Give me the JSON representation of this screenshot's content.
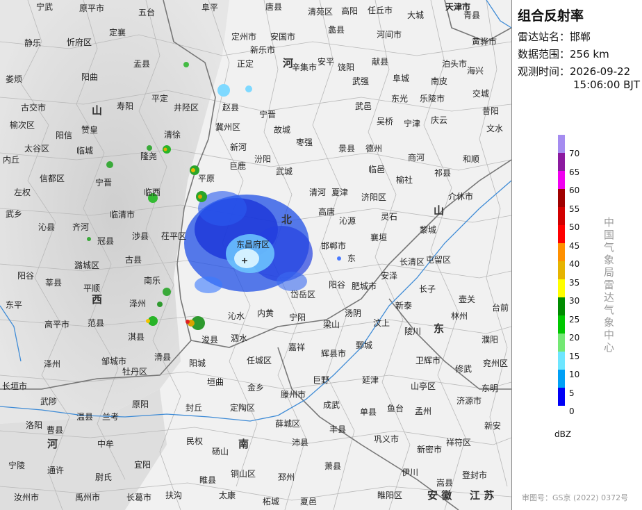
{
  "panel": {
    "title": "组合反射率",
    "station_label": "雷达站名：",
    "station_value": "邯郸",
    "range_label": "数据范围：",
    "range_value": "256 km",
    "time_label": "观测时间：",
    "date_value": "2026-09-22",
    "time_value": "15:06:00 BJT",
    "legend_unit": "dBZ",
    "source": "中国气象局雷达气象中心",
    "review_number": "审图号：GS京 (2022) 0372号",
    "legend": [
      {
        "label": "70",
        "color": "#a58cf0"
      },
      {
        "label": "65",
        "color": "#8c1aa0"
      },
      {
        "label": "60",
        "color": "#f000f0"
      },
      {
        "label": "55",
        "color": "#a00000"
      },
      {
        "label": "50",
        "color": "#d20000"
      },
      {
        "label": "45",
        "color": "#ff0000"
      },
      {
        "label": "40",
        "color": "#ff9000"
      },
      {
        "label": "35",
        "color": "#e6b400"
      },
      {
        "label": "30",
        "color": "#ffff00"
      },
      {
        "label": "25",
        "color": "#008c00"
      },
      {
        "label": "20",
        "color": "#00c800"
      },
      {
        "label": "15",
        "color": "#74e874"
      },
      {
        "label": "10",
        "color": "#6ee6ff"
      },
      {
        "label": "5",
        "color": "#00a0f6"
      },
      {
        "label": "0",
        "color": "#0000f6"
      }
    ]
  },
  "map": {
    "provinces": [
      "山",
      "西",
      "河",
      "北",
      "山",
      "东",
      "河",
      "南",
      "安 徽",
      "江 苏"
    ],
    "places": [
      "宁武",
      "原平市",
      "五台",
      "阜平",
      "唐县",
      "清苑区",
      "高阳",
      "任丘市",
      "大城",
      "天津市",
      "青县",
      "静乐",
      "忻府区",
      "定襄",
      "定州市",
      "安国市",
      "蠡县",
      "河间市",
      "黄骅市",
      "新乐市",
      "盂县",
      "正定",
      "辛集市",
      "安平",
      "饶阳",
      "献县",
      "泊头市",
      "海兴",
      "娄烦",
      "阳曲",
      "武强",
      "阜城",
      "南皮",
      "平定",
      "寿阳",
      "古交市",
      "井陉区",
      "赵县",
      "宁晋",
      "武邑",
      "东光",
      "乐陵市",
      "交城",
      "榆次区",
      "赞皇",
      "冀州区",
      "故城",
      "吴桥",
      "宁津",
      "庆云",
      "昔阳",
      "清徐",
      "阳信",
      "文水",
      "太谷区",
      "临城",
      "新河",
      "枣强",
      "景县",
      "德州",
      "商河",
      "和顺",
      "隆尧",
      "汾阳",
      "内丘",
      "巨鹿",
      "武城",
      "临邑",
      "祁县",
      "信都区",
      "平原",
      "榆社",
      "宁晋",
      "清河",
      "夏津",
      "济阳区",
      "介休市",
      "左权",
      "临西",
      "高唐",
      "灵石",
      "武乡",
      "临清市",
      "沁源",
      "沁县",
      "齐河",
      "黎城",
      "涉县",
      "茌平区",
      "襄垣",
      "冠县",
      "邯郸市",
      "东昌府区",
      "东",
      "长清区",
      "屯留区",
      "潞城区",
      "古县",
      "阳谷",
      "安泽",
      "莘县",
      "阳谷",
      "肥城市",
      "长子",
      "平顺",
      "南乐",
      "岱岳区",
      "壶关",
      "泽州",
      "东平",
      "新泰",
      "台前",
      "汤阴",
      "内黄",
      "宁阳",
      "林州",
      "沁水",
      "高平市",
      "范县",
      "梁山",
      "汶上",
      "陵川",
      "淇县",
      "浚县",
      "泗水",
      "濮阳",
      "嘉祥",
      "鄄城",
      "辉县市",
      "滑县",
      "任城区",
      "卫辉市",
      "阳城",
      "泽州",
      "邹城市",
      "兖州区",
      "修武",
      "牡丹区",
      "巨野",
      "延津",
      "垣曲",
      "长垣市",
      "金乡",
      "山亭区",
      "东明",
      "滕州市",
      "济源市",
      "武陟",
      "原阳",
      "封丘",
      "定陶区",
      "成武",
      "单县",
      "鱼台",
      "孟州",
      "温县",
      "兰考",
      "薛城区",
      "新安",
      "洛阳",
      "曹县",
      "丰县",
      "巩义市",
      "中牟",
      "民权",
      "沛县",
      "祥符区",
      "砀山",
      "新密市",
      "宜阳",
      "宁陵",
      "萧县",
      "伊川",
      "通许",
      "铜山区",
      "登封市",
      "尉氏",
      "睢县",
      "邳州",
      "嵩县",
      "汝州市",
      "禹州市",
      "长葛市",
      "扶沟",
      "太康",
      "柘城",
      "夏邑",
      "睢阳区"
    ]
  }
}
